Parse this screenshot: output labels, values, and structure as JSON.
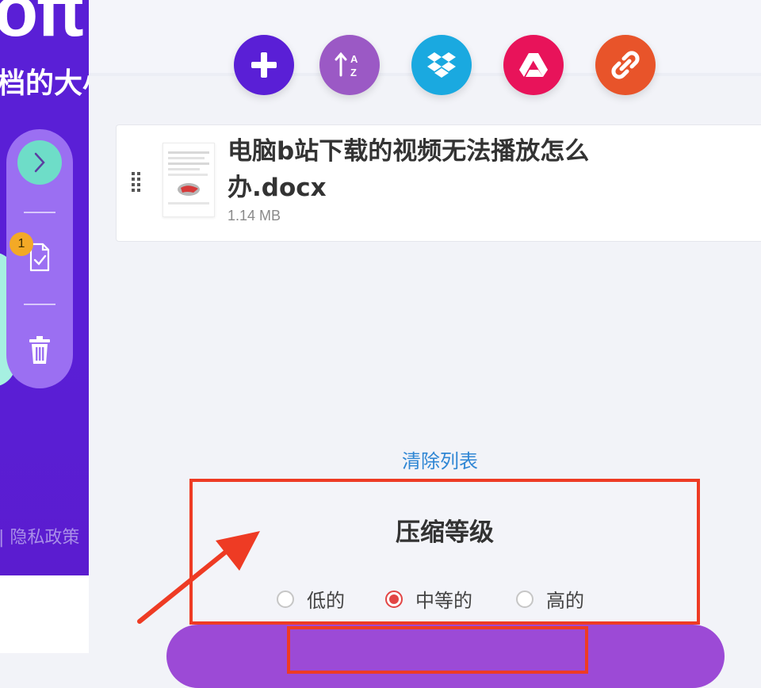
{
  "sidebar": {
    "brand_partial": "oft",
    "tagline_partial": "档的大小",
    "badge_count": "1",
    "privacy_partial": "| 隐私政策"
  },
  "toolbar": {
    "buttons": [
      {
        "name": "add",
        "icon": "plus-icon",
        "color": "#5a1fd6"
      },
      {
        "name": "sort",
        "icon": "sort-az-icon",
        "color": "#9b59c5"
      },
      {
        "name": "dropbox",
        "icon": "dropbox-icon",
        "color": "#1aa9e0"
      },
      {
        "name": "google-drive",
        "icon": "google-drive-icon",
        "color": "#e8135a"
      },
      {
        "name": "link",
        "icon": "link-icon",
        "color": "#e8542a"
      }
    ]
  },
  "file": {
    "name": "电脑b站下载的视频无法播放怎么办.docx",
    "size": "1.14 MB"
  },
  "clear_list": "清除列表",
  "compression": {
    "title": "压缩等级",
    "options": [
      {
        "label": "低的",
        "checked": false
      },
      {
        "label": "中等的",
        "checked": true
      },
      {
        "label": "高的",
        "checked": false
      }
    ]
  },
  "colors": {
    "accent_purple": "#5a1fd6",
    "highlight_red": "#ee3b24",
    "link_blue": "#2f86d4"
  }
}
